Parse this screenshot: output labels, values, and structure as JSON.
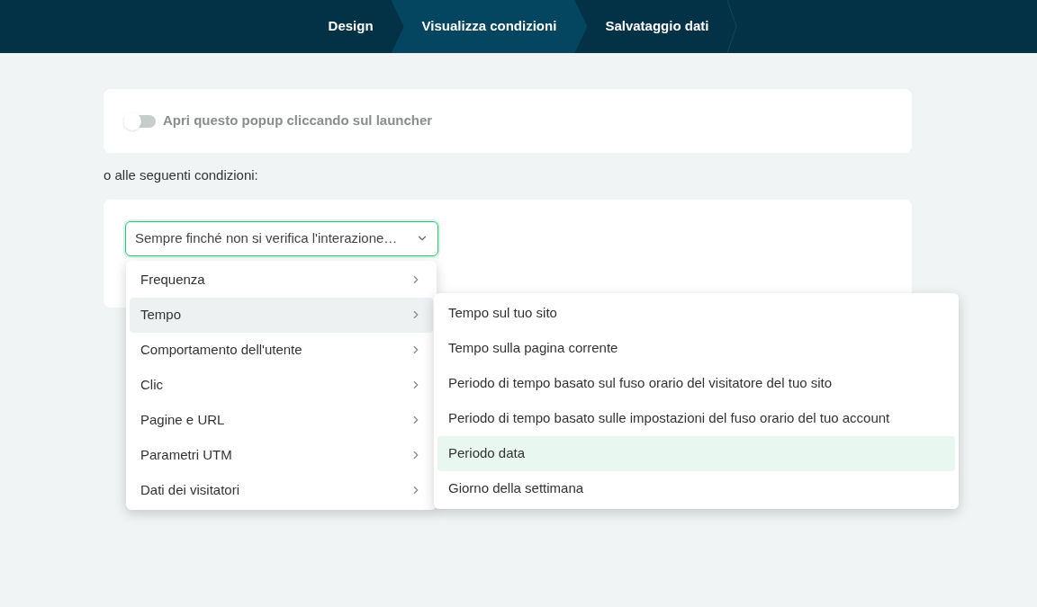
{
  "steps": [
    {
      "label": "Design",
      "selected": false
    },
    {
      "label": "Visualizza condizioni",
      "selected": true
    },
    {
      "label": "Salvataggio dati",
      "selected": false
    }
  ],
  "launcher_toggle": {
    "label": "Apri questo popup cliccando sul launcher",
    "on": false
  },
  "conditions_intro": "o alle seguenti condizioni:",
  "condition_select": {
    "value": "Sempre finché non si verifica l'interazione…"
  },
  "menu": [
    {
      "label": "Frequenza",
      "selected": false
    },
    {
      "label": "Tempo",
      "selected": true
    },
    {
      "label": "Comportamento dell'utente",
      "selected": false
    },
    {
      "label": "Clic",
      "selected": false
    },
    {
      "label": "Pagine e URL",
      "selected": false
    },
    {
      "label": "Parametri UTM",
      "selected": false
    },
    {
      "label": "Dati dei visitatori",
      "selected": false
    }
  ],
  "submenu": [
    {
      "label": "Tempo sul tuo sito",
      "selected": false
    },
    {
      "label": "Tempo sulla pagina corrente",
      "selected": false
    },
    {
      "label": "Periodo di tempo basato sul fuso orario del visitatore del tuo sito",
      "selected": false
    },
    {
      "label": "Periodo di tempo basato sulle impostazioni del fuso orario del tuo account",
      "selected": false
    },
    {
      "label": "Periodo data",
      "selected": true
    },
    {
      "label": "Giorno della settimana",
      "selected": false
    }
  ]
}
